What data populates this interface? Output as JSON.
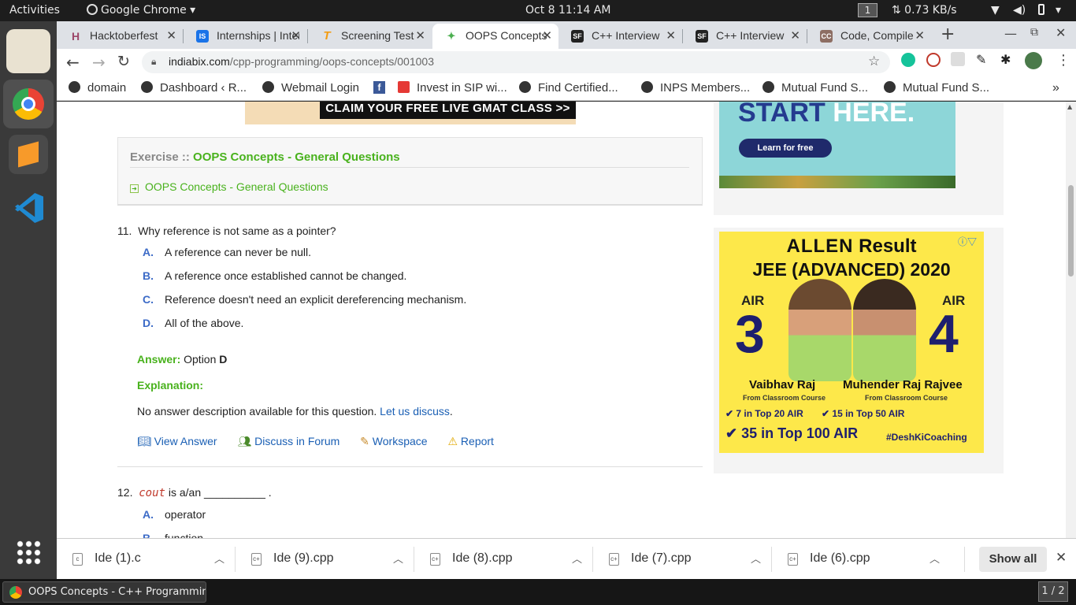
{
  "system": {
    "activities": "Activities",
    "app_name": "Google Chrome",
    "datetime": "Oct 8  11:14 AM",
    "workspace": "1",
    "net_speed": "⇅ 0.73 KB/s"
  },
  "tabs": [
    {
      "title": "Hacktoberfest",
      "favicon_text": "H",
      "color": "#9c4668"
    },
    {
      "title": "Internships | Internshala",
      "favicon_text": "IS",
      "color": "#1a73e8"
    },
    {
      "title": "Screening Test",
      "favicon_text": "T",
      "color": "#f39c12"
    },
    {
      "title": "OOPS Concepts",
      "favicon_text": "",
      "color": "#4caf50",
      "active": true
    },
    {
      "title": "C++ Interview",
      "favicon_text": "SF",
      "color": "#222"
    },
    {
      "title": "C++ Interview",
      "favicon_text": "SF",
      "color": "#222"
    },
    {
      "title": "Code, Compile",
      "favicon_text": "CC",
      "color": "#8d6e63"
    }
  ],
  "address": {
    "domain": "indiabix.com",
    "path": "/cpp-programming/oops-concepts/001003"
  },
  "bookmarks": [
    "domain",
    "Dashboard ‹ R...",
    "Webmail Login",
    "f",
    "Invest in SIP wi...",
    "Find Certified...",
    "INPS Members...",
    "Mutual Fund S...",
    "Mutual Fund S..."
  ],
  "ads": {
    "gmat_banner": "CLAIM YOUR FREE LIVE GMAT CLASS >>",
    "start_here_1": "START",
    "start_here_2": "HERE.",
    "learn_btn": "Learn for free",
    "allen_brand": "ALLEN",
    "allen_result": "Result",
    "allen_exam": "JEE (ADVANCED) 2020",
    "air_label": "AIR",
    "rank_left": "3",
    "rank_right": "4",
    "name_left": "Vaibhav Raj",
    "name_right": "Muhender Raj Rajvee",
    "course_left": "From Classroom Course",
    "course_right": "From Classroom Course",
    "stat1": "7 in Top 20 AIR",
    "stat2": "15 in Top 50 AIR",
    "stat3": "35 in Top 100 AIR",
    "hashtag": "#DeshKiCoaching"
  },
  "exercise": {
    "prefix": "Exercise :: ",
    "name": "OOPS Concepts - General Questions",
    "sublink": "OOPS Concepts - General Questions"
  },
  "q11": {
    "number": "11.",
    "text": "Why reference is not same as a pointer?",
    "options": [
      {
        "letter": "A.",
        "text": "A reference can never be null."
      },
      {
        "letter": "B.",
        "text": "A reference once established cannot be changed."
      },
      {
        "letter": "C.",
        "text": "Reference doesn't need an explicit dereferencing mechanism."
      },
      {
        "letter": "D.",
        "text": "All of the above."
      }
    ],
    "answer_label": "Answer:",
    "answer_pre": "Option",
    "answer_value": "D",
    "explanation_label": "Explanation:",
    "explanation_text": "No answer description available for this question.",
    "discuss_link": "Let us discuss",
    "actions": [
      "View Answer",
      "Discuss in Forum",
      "Workspace",
      "Report"
    ]
  },
  "q12": {
    "number": "12.",
    "code": "cout",
    "text": "is a/an __________ .",
    "options": [
      {
        "letter": "A.",
        "text": "operator"
      },
      {
        "letter": "B.",
        "text": "function"
      }
    ]
  },
  "downloads": {
    "items": [
      "Ide (1).c",
      "Ide (9).cpp",
      "Ide (8).cpp",
      "Ide (7).cpp",
      "Ide (6).cpp"
    ],
    "show_all": "Show all"
  },
  "taskbar": {
    "window_title": "OOPS Concepts - C++ Programmin...",
    "pager": "1 / 2"
  }
}
